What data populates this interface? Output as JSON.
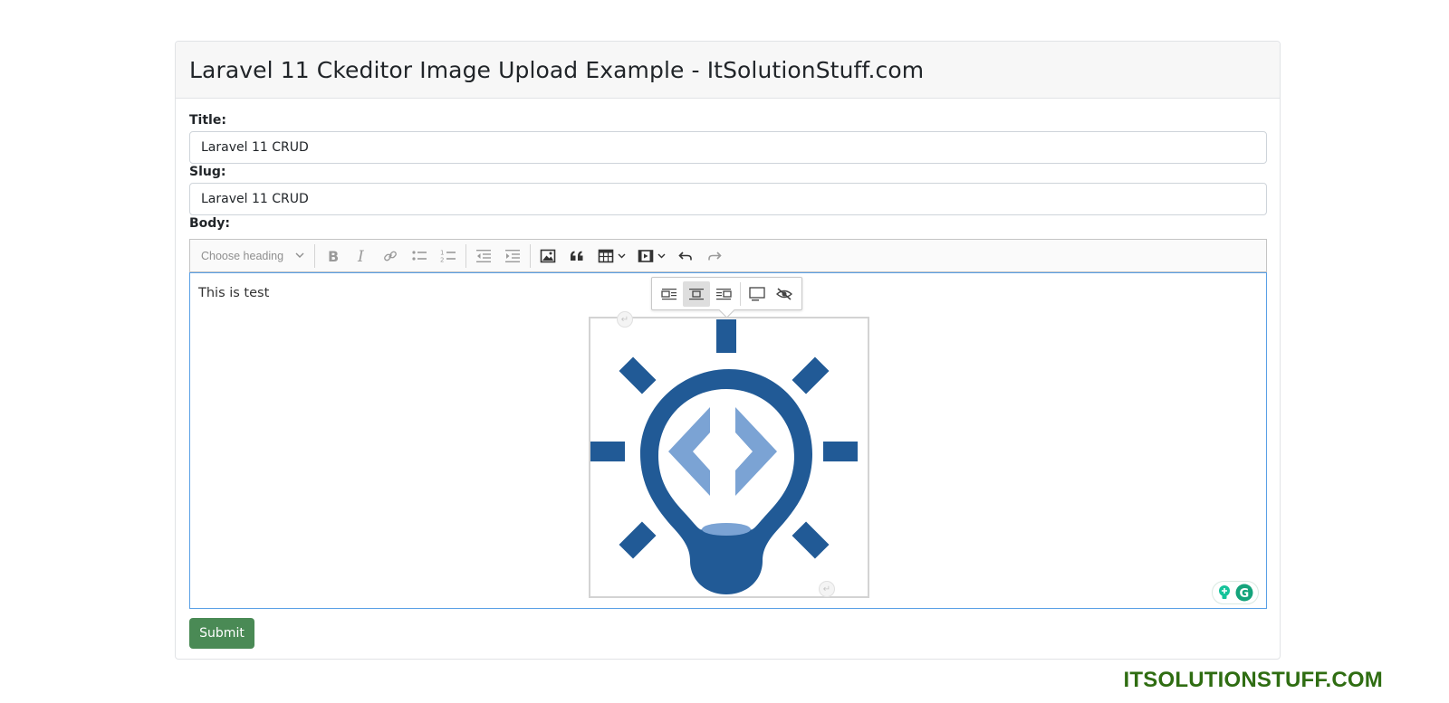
{
  "header": {
    "title": "Laravel 11 Ckeditor Image Upload Example - ItSolutionStuff.com"
  },
  "form": {
    "title_label": "Title:",
    "title_value": "Laravel 11 CRUD",
    "slug_label": "Slug:",
    "slug_value": "Laravel 11 CRUD",
    "body_label": "Body:",
    "submit_label": "Submit"
  },
  "editor": {
    "heading_placeholder": "Choose heading",
    "content_text": "This is test",
    "toolbar_icons": [
      "bold-icon",
      "italic-icon",
      "link-icon",
      "bulleted-list-icon",
      "numbered-list-icon",
      "outdent-icon",
      "indent-icon",
      "insert-image-icon",
      "block-quote-icon",
      "insert-table-icon",
      "insert-media-icon",
      "undo-icon",
      "redo-icon"
    ],
    "image_toolbar_icons": [
      "image-align-left-icon",
      "image-align-center-icon",
      "image-align-right-icon",
      "image-caption-icon",
      "alt-text-icon"
    ],
    "image_icon": "lightbulb-code-logo"
  },
  "colors": {
    "logo_dark_blue": "#215a96",
    "logo_light_blue": "#7ba3d4",
    "submit_green": "#4a8a55",
    "brand_green": "#2f6d12",
    "editor_focus_border": "#5aa0e6"
  },
  "watermark": {
    "text": "ITSOLUTIONSTUFF.COM"
  }
}
